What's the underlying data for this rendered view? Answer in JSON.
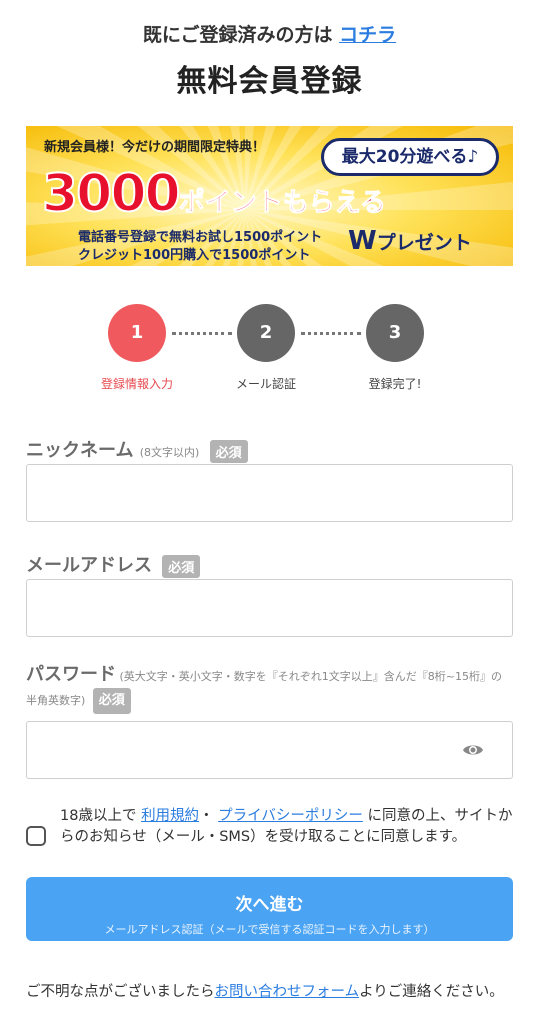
{
  "header": {
    "login_prompt": "既にご登録済みの方は",
    "login_link": "コチラ",
    "title": "無料会員登録"
  },
  "banner": {
    "top_text": "新規会員様！今だけの期間限定特典！",
    "bubble": "最大20分遊べる♪",
    "big_number": "3000",
    "big_rest": "ポイントもらえる",
    "sub1": "電話番号登録で無料お試し1500ポイント",
    "sub2": "クレジット100円購入で1500ポイント",
    "w": "W",
    "present": "プレゼント"
  },
  "steps": [
    {
      "number": "1",
      "label": "登録情報入力",
      "active": true
    },
    {
      "number": "2",
      "label": "メール認証",
      "active": false
    },
    {
      "number": "3",
      "label": "登録完了!",
      "active": false
    }
  ],
  "form": {
    "nickname_label": "ニックネーム",
    "nickname_note": "(8文字以内)",
    "nickname_value": "",
    "email_label": "メールアドレス",
    "email_value": "",
    "password_label": "パスワード",
    "password_note": "(英大文字・英小文字・数字を『それぞれ1文字以上』含んだ『8桁~15桁』の半角英数字)",
    "password_value": "",
    "required_badge": "必須"
  },
  "consent": {
    "prefix": "18歳以上で",
    "terms_link": "利用規約",
    "separator": "・",
    "privacy_link": "プライバシーポリシー",
    "suffix": "に同意の上、サイトからのお知らせ（メール・SMS）を受け取ることに同意します。",
    "checked": false
  },
  "submit": {
    "label": "次へ進む",
    "sublabel": "メールアドレス認証（メールで受信する認証コードを入力します）"
  },
  "footer": {
    "prefix": "ご不明な点がございましたら",
    "link": "お問い合わせフォーム",
    "suffix": "よりご連絡ください。"
  },
  "colors": {
    "accent": "#4aa3f3",
    "step_active": "#f05a5e",
    "step_inactive": "#666666",
    "link": "#2b7de0"
  },
  "icons": {
    "password_toggle": "eye-icon",
    "consent_checkbox": "checkbox-icon"
  }
}
